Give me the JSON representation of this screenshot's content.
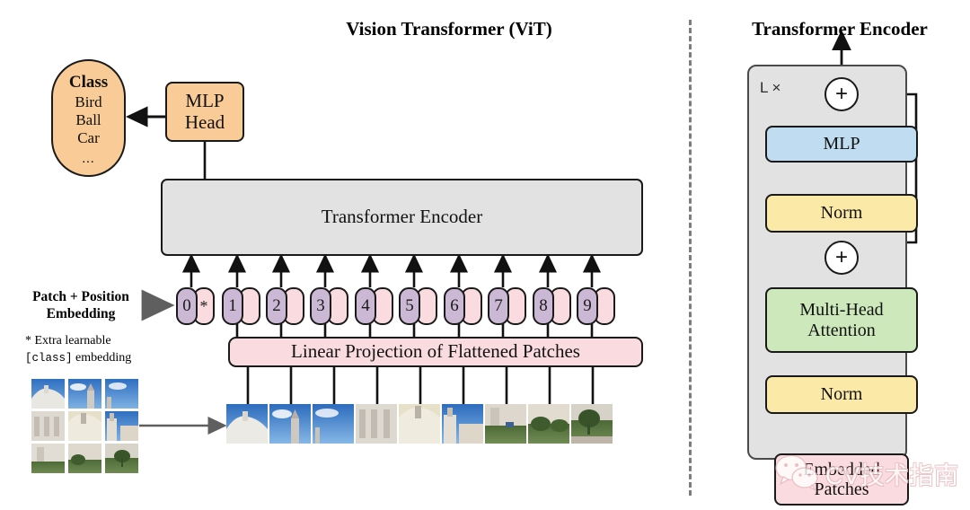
{
  "left_panel": {
    "title": "Vision Transformer (ViT)",
    "class_box": {
      "title": "Class",
      "items": [
        "Bird",
        "Ball",
        "Car"
      ],
      "ellipsis": "...",
      "color": "#f9cb97"
    },
    "mlp_head": {
      "line1": "MLP",
      "line2": "Head",
      "color": "#f9cb97"
    },
    "encoder_box": {
      "label": "Transformer Encoder",
      "color": "#e2e2e2"
    },
    "linear_projection": {
      "label": "Linear Projection of Flattened Patches",
      "color": "#fadce0"
    },
    "embedding_label": {
      "line1": "Patch + Position",
      "line2": "Embedding"
    },
    "extra_note": {
      "line1": "* Extra learnable",
      "mono_token": "[class]",
      "line2_rest": " embedding"
    },
    "tokens": [
      {
        "number": "0",
        "embedding_mark": "*"
      },
      {
        "number": "1",
        "embedding_mark": ""
      },
      {
        "number": "2",
        "embedding_mark": ""
      },
      {
        "number": "3",
        "embedding_mark": ""
      },
      {
        "number": "4",
        "embedding_mark": ""
      },
      {
        "number": "5",
        "embedding_mark": ""
      },
      {
        "number": "6",
        "embedding_mark": ""
      },
      {
        "number": "7",
        "embedding_mark": ""
      },
      {
        "number": "8",
        "embedding_mark": ""
      },
      {
        "number": "9",
        "embedding_mark": ""
      }
    ],
    "token_colors": {
      "number_pill": "#cbb8d4",
      "embedding_pill": "#fadce0"
    },
    "source_image": {
      "grid_rows": 3,
      "grid_cols": 3,
      "patch_count": 9
    }
  },
  "right_panel": {
    "title": "Transformer Encoder",
    "repeat_label": "L ×",
    "panel_color": "#e2e2e2",
    "blocks": [
      {
        "name": "add-top",
        "label": "+",
        "type": "residual-add"
      },
      {
        "name": "mlp",
        "label": "MLP",
        "color": "#bfdcf0"
      },
      {
        "name": "norm-upper",
        "label": "Norm",
        "color": "#fbe9a8"
      },
      {
        "name": "add-bottom",
        "label": "+",
        "type": "residual-add"
      },
      {
        "name": "multi-head-attention",
        "line1": "Multi-Head",
        "line2": "Attention",
        "color": "#cde8bb"
      },
      {
        "name": "norm-lower",
        "label": "Norm",
        "color": "#fbe9a8"
      },
      {
        "name": "embedded-patches",
        "line1": "Embedded",
        "line2": "Patches",
        "color": "#fadce0"
      }
    ]
  },
  "watermark": {
    "text": "CV技术指南"
  }
}
